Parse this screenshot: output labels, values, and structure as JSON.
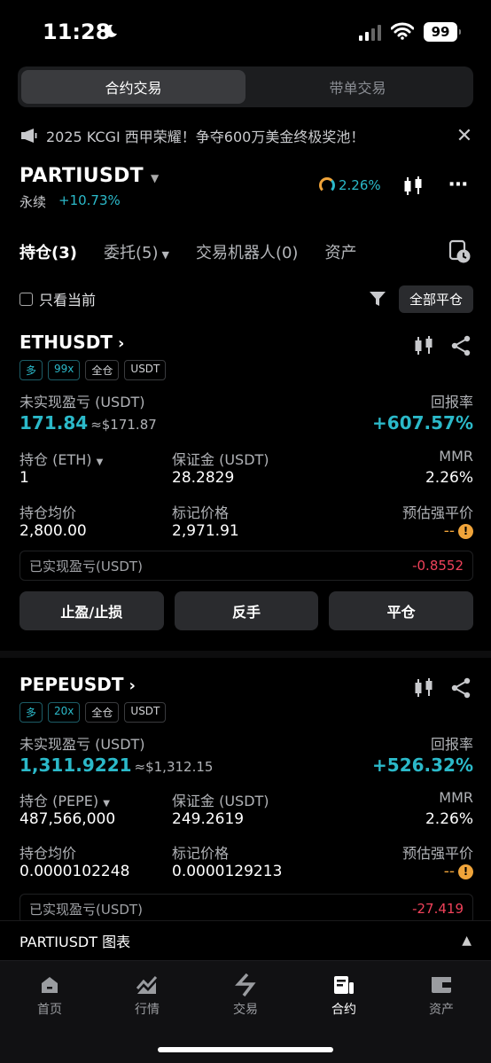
{
  "status_bar": {
    "time": "11:28",
    "battery": "99"
  },
  "mode_tabs": [
    {
      "label": "合约交易",
      "active": true
    },
    {
      "label": "带单交易",
      "active": false
    }
  ],
  "announcement": {
    "text": "2025 KCGI 西甲荣耀！争夺600万美金终极奖池！"
  },
  "header": {
    "symbol": "PARTIUSDT",
    "type": "永续",
    "change": "+10.73%",
    "ratio": "2.26%"
  },
  "tabs": [
    {
      "label": "持仓(3)",
      "active": true
    },
    {
      "label": "委托(5)",
      "dropdown": true
    },
    {
      "label": "交易机器人(0)"
    },
    {
      "label": "资产"
    }
  ],
  "filter": {
    "only_current": "只看当前",
    "close_all": "全部平仓"
  },
  "positions": [
    {
      "symbol": "ETHUSDT",
      "badges": [
        "多",
        "99x",
        "全仓",
        "USDT"
      ],
      "unrealized_label": "未实现盈亏 (USDT)",
      "unrealized": "171.84",
      "unrealized_usd": "≈$171.87",
      "roe_label": "回报率",
      "roe": "+607.57%",
      "size_label": "持仓 (ETH)",
      "size": "1",
      "margin_label": "保证金 (USDT)",
      "margin": "28.2829",
      "mmr_label": "MMR",
      "mmr": "2.26%",
      "entry_label": "持仓均价",
      "entry": "2,800.00",
      "mark_label": "标记价格",
      "mark": "2,971.91",
      "liq_label": "预估强平价",
      "liq": "--",
      "realized_label": "已实现盈亏(USDT)",
      "realized": "-0.8552",
      "actions": [
        "止盈/止损",
        "反手",
        "平仓"
      ]
    },
    {
      "symbol": "PEPEUSDT",
      "badges": [
        "多",
        "20x",
        "全仓",
        "USDT"
      ],
      "unrealized_label": "未实现盈亏 (USDT)",
      "unrealized": "1,311.9221",
      "unrealized_usd": "≈$1,312.15",
      "roe_label": "回报率",
      "roe": "+526.32%",
      "size_label": "持仓 (PEPE)",
      "size": "487,566,000",
      "margin_label": "保证金 (USDT)",
      "margin": "249.2619",
      "mmr_label": "MMR",
      "mmr": "2.26%",
      "entry_label": "持仓均价",
      "entry": "0.0000102248",
      "mark_label": "标记价格",
      "mark": "0.0000129213",
      "liq_label": "预估强平价",
      "liq": "--",
      "realized_label": "已实现盈亏(USDT)",
      "realized": "-27.419"
    }
  ],
  "chart_bar": {
    "label": "PARTIUSDT 图表"
  },
  "bottom_nav": [
    {
      "label": "首页",
      "icon": "home-icon"
    },
    {
      "label": "行情",
      "icon": "market-chart-icon"
    },
    {
      "label": "交易",
      "icon": "trade-swap-icon"
    },
    {
      "label": "合约",
      "icon": "futures-icon",
      "active": true
    },
    {
      "label": "资产",
      "icon": "wallet-icon"
    }
  ],
  "colors": {
    "accent": "#2bb9c9",
    "loss": "#f0425a",
    "warning": "#f0a43a"
  }
}
